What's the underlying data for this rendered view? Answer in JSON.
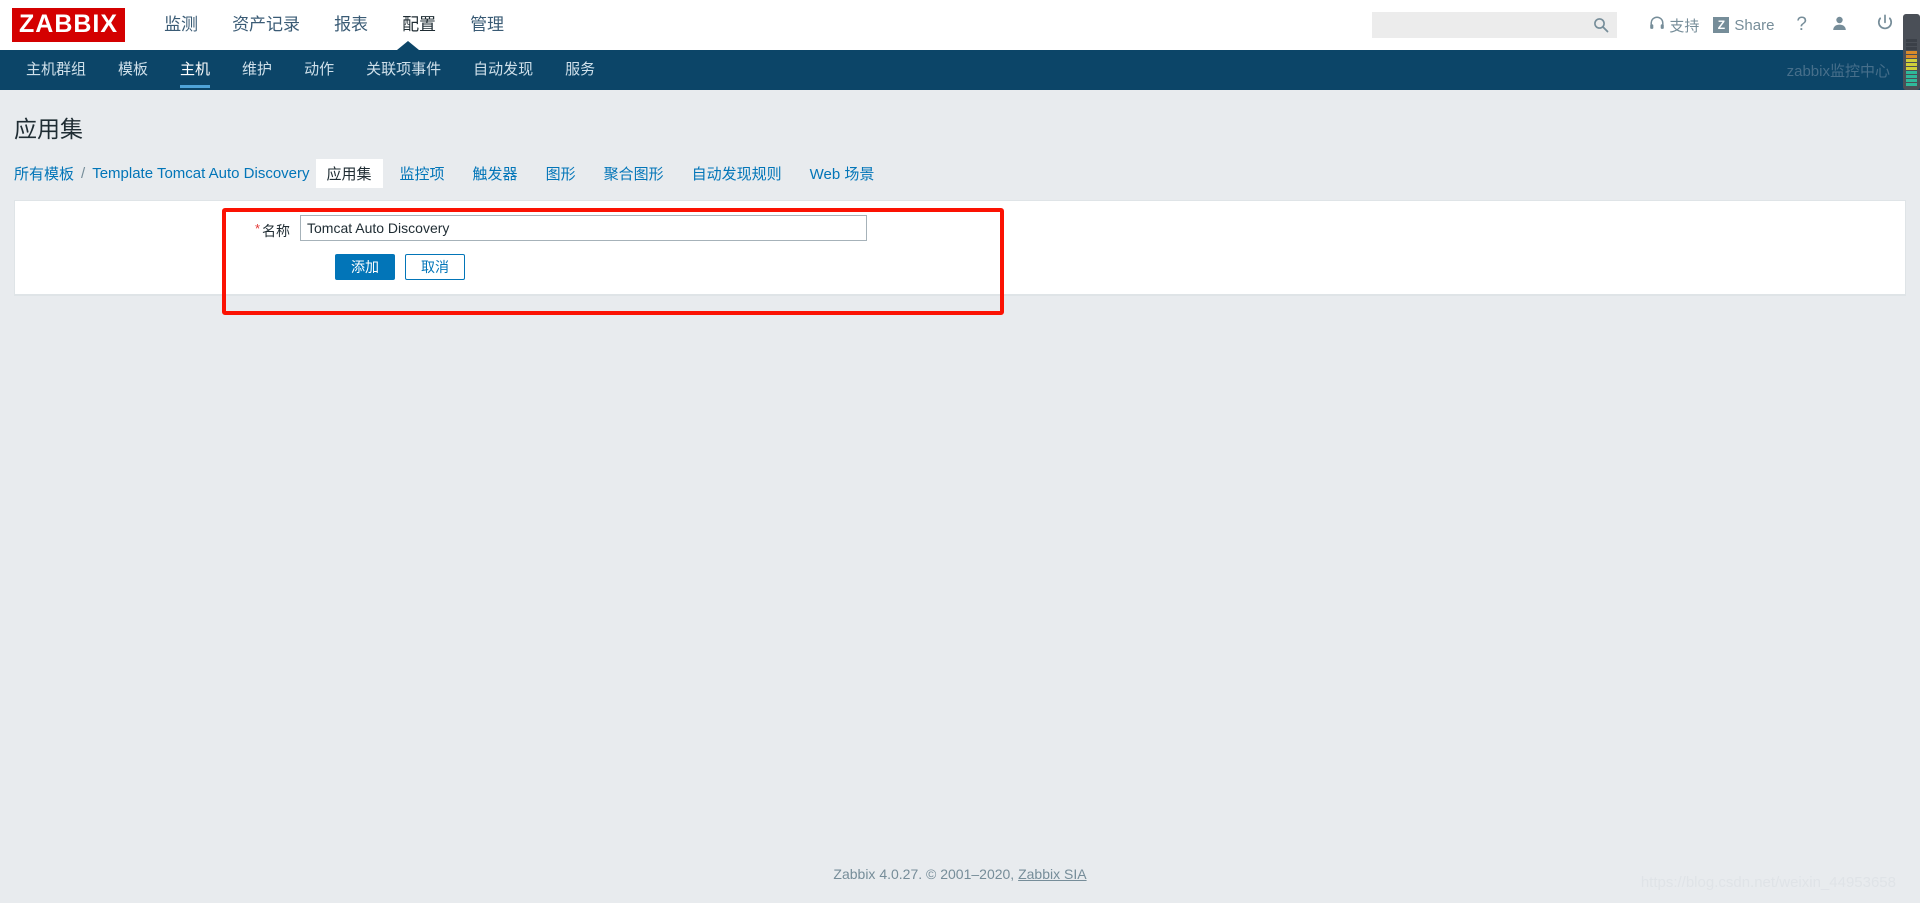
{
  "header": {
    "logo_text": "ZABBIX",
    "main_nav": [
      {
        "label": "监测",
        "active": false
      },
      {
        "label": "资产记录",
        "active": false
      },
      {
        "label": "报表",
        "active": false
      },
      {
        "label": "配置",
        "active": true
      },
      {
        "label": "管理",
        "active": false
      }
    ],
    "search": {
      "value": "",
      "placeholder": ""
    },
    "support_label": "支持",
    "share_badge": "Z",
    "share_label": "Share",
    "help_label": "?",
    "icons": {
      "search": "search-icon",
      "support": "headset-icon",
      "share": "share-icon",
      "help": "question-mark-icon",
      "user": "user-profile-icon",
      "signout": "power-signout-icon"
    }
  },
  "subnav": {
    "items": [
      {
        "label": "主机群组",
        "active": false
      },
      {
        "label": "模板",
        "active": false
      },
      {
        "label": "主机",
        "active": true
      },
      {
        "label": "维护",
        "active": false
      },
      {
        "label": "动作",
        "active": false
      },
      {
        "label": "关联项事件",
        "active": false
      },
      {
        "label": "自动发现",
        "active": false
      },
      {
        "label": "服务",
        "active": false
      }
    ],
    "right_label": "zabbix监控中心"
  },
  "page": {
    "title": "应用集"
  },
  "breadcrumb": {
    "root": "所有模板",
    "separator": "/",
    "current": "Template Tomcat Auto Discovery"
  },
  "tabs": [
    {
      "label": "应用集",
      "active": true
    },
    {
      "label": "监控项",
      "active": false
    },
    {
      "label": "触发器",
      "active": false
    },
    {
      "label": "图形",
      "active": false
    },
    {
      "label": "聚合图形",
      "active": false
    },
    {
      "label": "自动发现规则",
      "active": false
    },
    {
      "label": "Web 场景",
      "active": false
    }
  ],
  "form": {
    "required_marker": "*",
    "name_label": "名称",
    "name_value": "Tomcat Auto Discovery",
    "name_placeholder": "",
    "submit_label": "添加",
    "cancel_label": "取消"
  },
  "annotation": {
    "color": "#fb1203",
    "shape": "rectangle"
  },
  "footer": {
    "text": "Zabbix 4.0.27. © 2001–2020,",
    "link_label": "Zabbix SIA"
  },
  "watermark": {
    "text": "https://blog.csdn.net/weixin_44953658"
  },
  "colors": {
    "brand_red": "#d40000",
    "subnav_navy": "#0c4568",
    "accent_blue": "#0275b8",
    "page_bg": "#e8ebee",
    "link": "#0275b8",
    "annotation_red": "#fb1203"
  }
}
